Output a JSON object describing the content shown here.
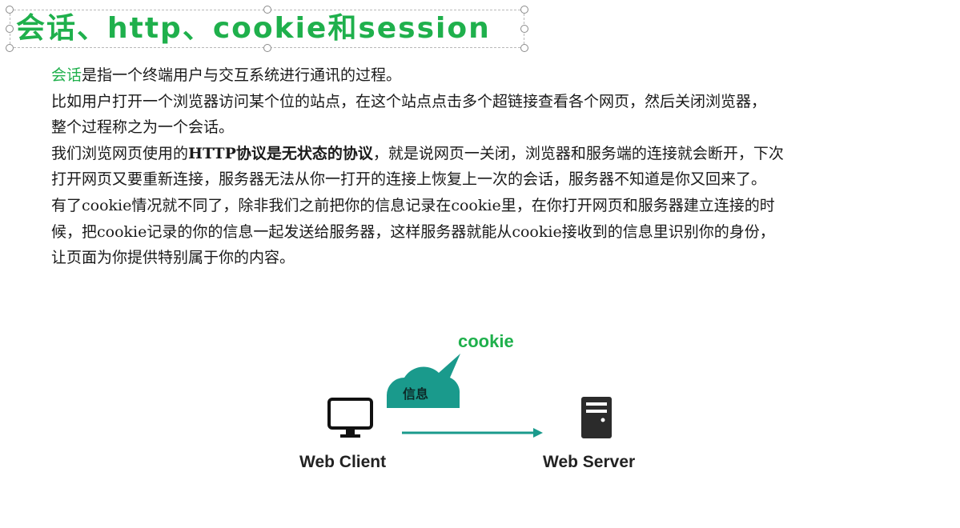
{
  "title": "会话、http、cookie和session",
  "paragraphs": {
    "line1_highlight": "会话",
    "line1_rest": "是指一个终端用户与交互系统进行通讯的过程。",
    "line2": "比如用户打开一个浏览器访问某个位的站点，在这个站点点击多个超链接查看各个网页，然后关闭浏览器，",
    "line3": "整个过程称之为一个会话。",
    "line4_pre": "我们浏览网页使用的",
    "line4_bold": "HTTP协议是无状态的协议",
    "line4_post": "，就是说网页一关闭，浏览器和服务端的连接就会断开，下次",
    "line5": "打开网页又要重新连接，服务器无法从你一打开的连接上恢复上一次的会话，服务器不知道是你又回来了。",
    "line6": "有了cookie情况就不同了，除非我们之前把你的信息记录在cookie里，在你打开网页和服务器建立连接的时",
    "line7": "候，把cookie记录的你的信息一起发送给服务器，这样服务器就能从cookie接收到的信息里识别你的身份，",
    "line8": "让页面为你提供特别属于你的内容。"
  },
  "diagram": {
    "cookie_label": "cookie",
    "cloud_label": "信息",
    "client_label": "Web Client",
    "server_label": "Web Server",
    "client_icon": "monitor-icon",
    "server_icon": "server-icon",
    "accent_color": "#1fb04c",
    "cloud_color": "#1a9a8c",
    "arrow_color": "#1a9a8c"
  }
}
